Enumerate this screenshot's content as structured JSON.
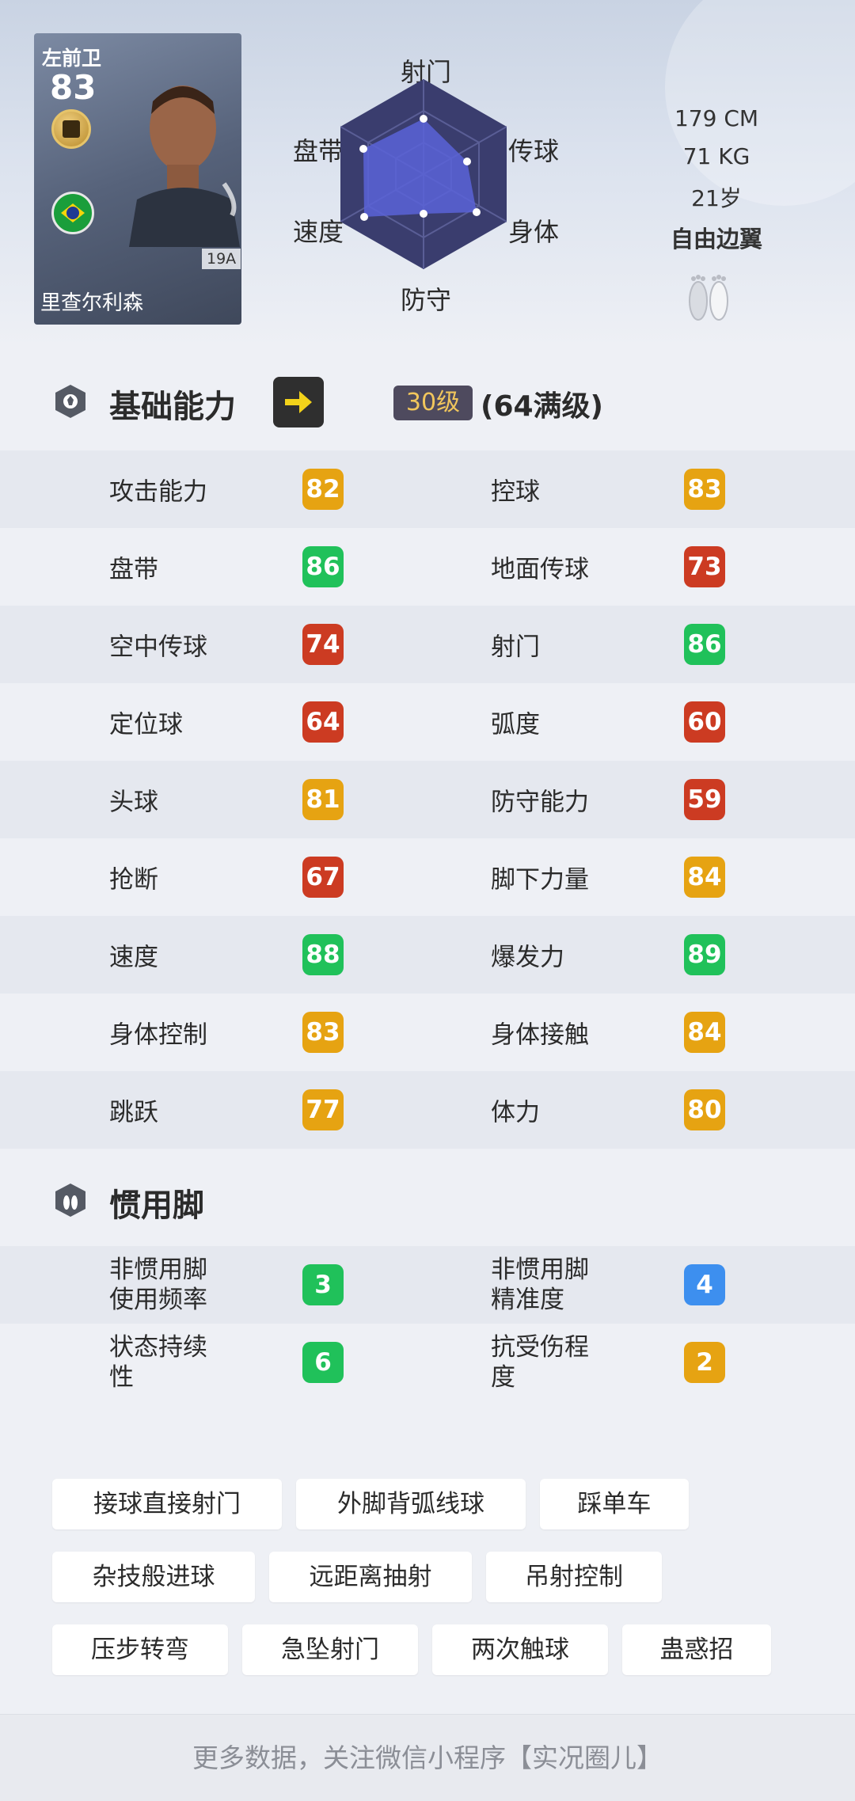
{
  "colors": {
    "green": "#20c15a",
    "amber": "#e6a312",
    "red": "#cc3b22",
    "blue": "#3d8fef"
  },
  "player": {
    "position": "左前卫",
    "overall": "83",
    "name": "里查尔利森",
    "version": "19A",
    "badge_icon": "club-badge-icon",
    "flag_icon": "brazil-flag-icon"
  },
  "radar": {
    "labels": {
      "shooting": "射门",
      "passing": "传球",
      "physical": "身体",
      "defending": "防守",
      "speed": "速度",
      "dribbling": "盘带"
    }
  },
  "info": {
    "height": "179 CM",
    "weight": "71 KG",
    "age": "21岁",
    "play_style": "自由边翼",
    "feet_icon": "feet-icon"
  },
  "basic": {
    "title": "基础能力",
    "level": "30级",
    "max_level": "(64满级)",
    "stats": [
      {
        "left_label": "攻击能力",
        "left_value": "82",
        "left_color": "amber",
        "right_label": "控球",
        "right_value": "83",
        "right_color": "amber"
      },
      {
        "left_label": "盘带",
        "left_value": "86",
        "left_color": "green",
        "right_label": "地面传球",
        "right_value": "73",
        "right_color": "red"
      },
      {
        "left_label": "空中传球",
        "left_value": "74",
        "left_color": "red",
        "right_label": "射门",
        "right_value": "86",
        "right_color": "green"
      },
      {
        "left_label": "定位球",
        "left_value": "64",
        "left_color": "red",
        "right_label": "弧度",
        "right_value": "60",
        "right_color": "red"
      },
      {
        "left_label": "头球",
        "left_value": "81",
        "left_color": "amber",
        "right_label": "防守能力",
        "right_value": "59",
        "right_color": "red"
      },
      {
        "left_label": "抢断",
        "left_value": "67",
        "left_color": "red",
        "right_label": "脚下力量",
        "right_value": "84",
        "right_color": "amber"
      },
      {
        "left_label": "速度",
        "left_value": "88",
        "left_color": "green",
        "right_label": "爆发力",
        "right_value": "89",
        "right_color": "green"
      },
      {
        "left_label": "身体控制",
        "left_value": "83",
        "left_color": "amber",
        "right_label": "身体接触",
        "right_value": "84",
        "right_color": "amber"
      },
      {
        "left_label": "跳跃",
        "left_value": "77",
        "left_color": "amber",
        "right_label": "体力",
        "right_value": "80",
        "right_color": "amber"
      }
    ]
  },
  "foot": {
    "title": "惯用脚",
    "stats": [
      {
        "left_label_1": "非惯用脚",
        "left_label_2": "使用频率",
        "left_value": "3",
        "left_color": "green",
        "right_label_1": "非惯用脚",
        "right_label_2": "精准度",
        "right_value": "4",
        "right_color": "blue"
      },
      {
        "left_label_1": "状态持续",
        "left_label_2": "性",
        "left_value": "6",
        "left_color": "green",
        "right_label_1": "抗受伤程",
        "right_label_2": "度",
        "right_value": "2",
        "right_color": "amber"
      }
    ]
  },
  "skills": [
    "接球直接射门",
    "外脚背弧线球",
    "踩单车",
    "杂技般进球",
    "远距离抽射",
    "吊射控制",
    "压步转弯",
    "急坠射门",
    "两次触球",
    "蛊惑招"
  ],
  "footer": {
    "text": "更多数据，关注微信小程序【实况圈儿】"
  }
}
